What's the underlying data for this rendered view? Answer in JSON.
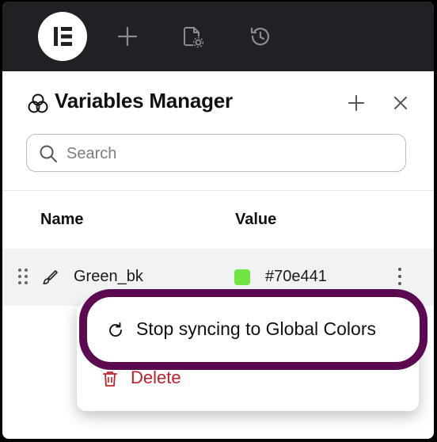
{
  "panel": {
    "title": "Variables Manager",
    "search_placeholder": "Search"
  },
  "table": {
    "columns": [
      "Name",
      "Value"
    ],
    "rows": [
      {
        "name": "Green_bk",
        "value": "#70e441",
        "swatch_color": "#70e441"
      }
    ]
  },
  "context_menu": {
    "items": [
      {
        "label": "Stop syncing to Global Colors",
        "icon": "refresh-icon"
      },
      {
        "label": "Delete",
        "icon": "trash-icon",
        "color": "#c0202a"
      }
    ]
  },
  "colors": {
    "topbar": "#1f2124",
    "highlight": "#5b0a52",
    "danger": "#c0202a"
  },
  "icons": {
    "topbar": [
      "elementor-logo",
      "plus-icon",
      "page-settings-icon",
      "history-icon"
    ],
    "header": [
      "variables-icon",
      "plus-icon",
      "close-icon"
    ]
  }
}
